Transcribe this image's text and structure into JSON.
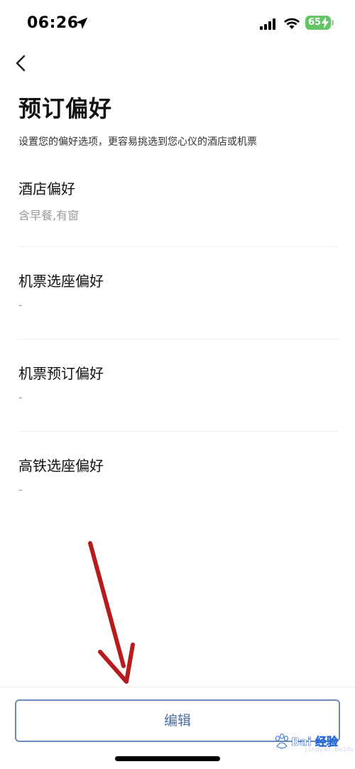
{
  "status_bar": {
    "time": "06:26",
    "battery_level": "65",
    "icons": [
      "location-arrow-icon",
      "signal-icon",
      "wifi-icon",
      "battery-icon"
    ]
  },
  "header": {
    "back_icon": "chevron-left-icon",
    "title": "预订偏好",
    "subtitle": "设置您的偏好选项，更容易挑选到您心仪的酒店或机票"
  },
  "preferences": [
    {
      "title": "酒店偏好",
      "value": "含早餐,有窗"
    },
    {
      "title": "机票选座偏好",
      "value": "-"
    },
    {
      "title": "机票预订偏好",
      "value": "-"
    },
    {
      "title": "高铁选座偏好",
      "value": "-"
    }
  ],
  "footer": {
    "edit_label": "编辑"
  },
  "watermark": {
    "text": "Bai 经验",
    "sub": "jingyan.baidu.com"
  },
  "colors": {
    "accent": "#4a6fa5",
    "button_border": "#6e8ab8",
    "value_gray": "#9a9a9a",
    "battery_green": "#65c466",
    "annotation_red": "#b71c1c"
  }
}
